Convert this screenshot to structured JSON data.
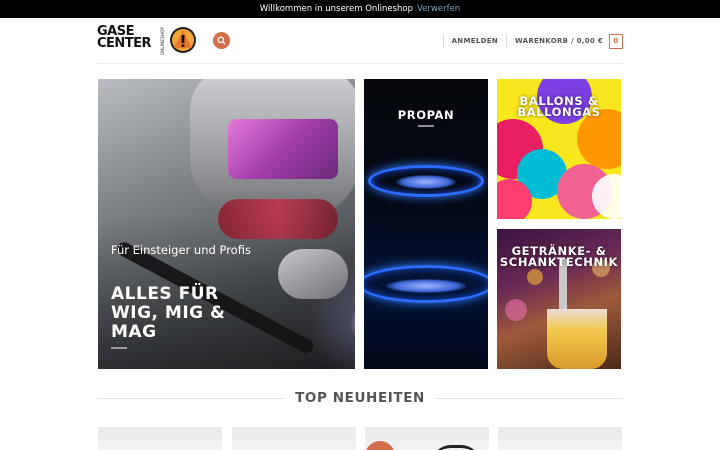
{
  "notice": {
    "message": "Willkommen in unserem Onlineshop",
    "dismiss_label": "Verwerfen"
  },
  "header": {
    "logo": {
      "line1": "GASE",
      "line2": "CENTER",
      "sub": "ONLINESHOP"
    },
    "nav": {
      "login_label": "ANMELDEN",
      "cart_label": "WARENKORB / 0,00 €",
      "cart_count": "0"
    }
  },
  "banners": {
    "welding": {
      "subtitle": "Für Einsteiger und Profis",
      "title": "ALLES FÜR WIG, MIG & MAG"
    },
    "propan": {
      "title": "PROPAN"
    },
    "ballons": {
      "title": "BALLONS & BALLONGAS"
    },
    "getraenke": {
      "title": "GETRÄNKE- & SCHANKTECHNIK"
    }
  },
  "section": {
    "title": "TOP NEUHEITEN"
  },
  "colors": {
    "accent": "#d26e4b",
    "notice_bg": "#000000",
    "dismiss_link": "#7da2bf",
    "flame_blue": "#2c6cff"
  },
  "icons": {
    "search": "search-icon",
    "logo_mark": "warning-gas-icon"
  }
}
